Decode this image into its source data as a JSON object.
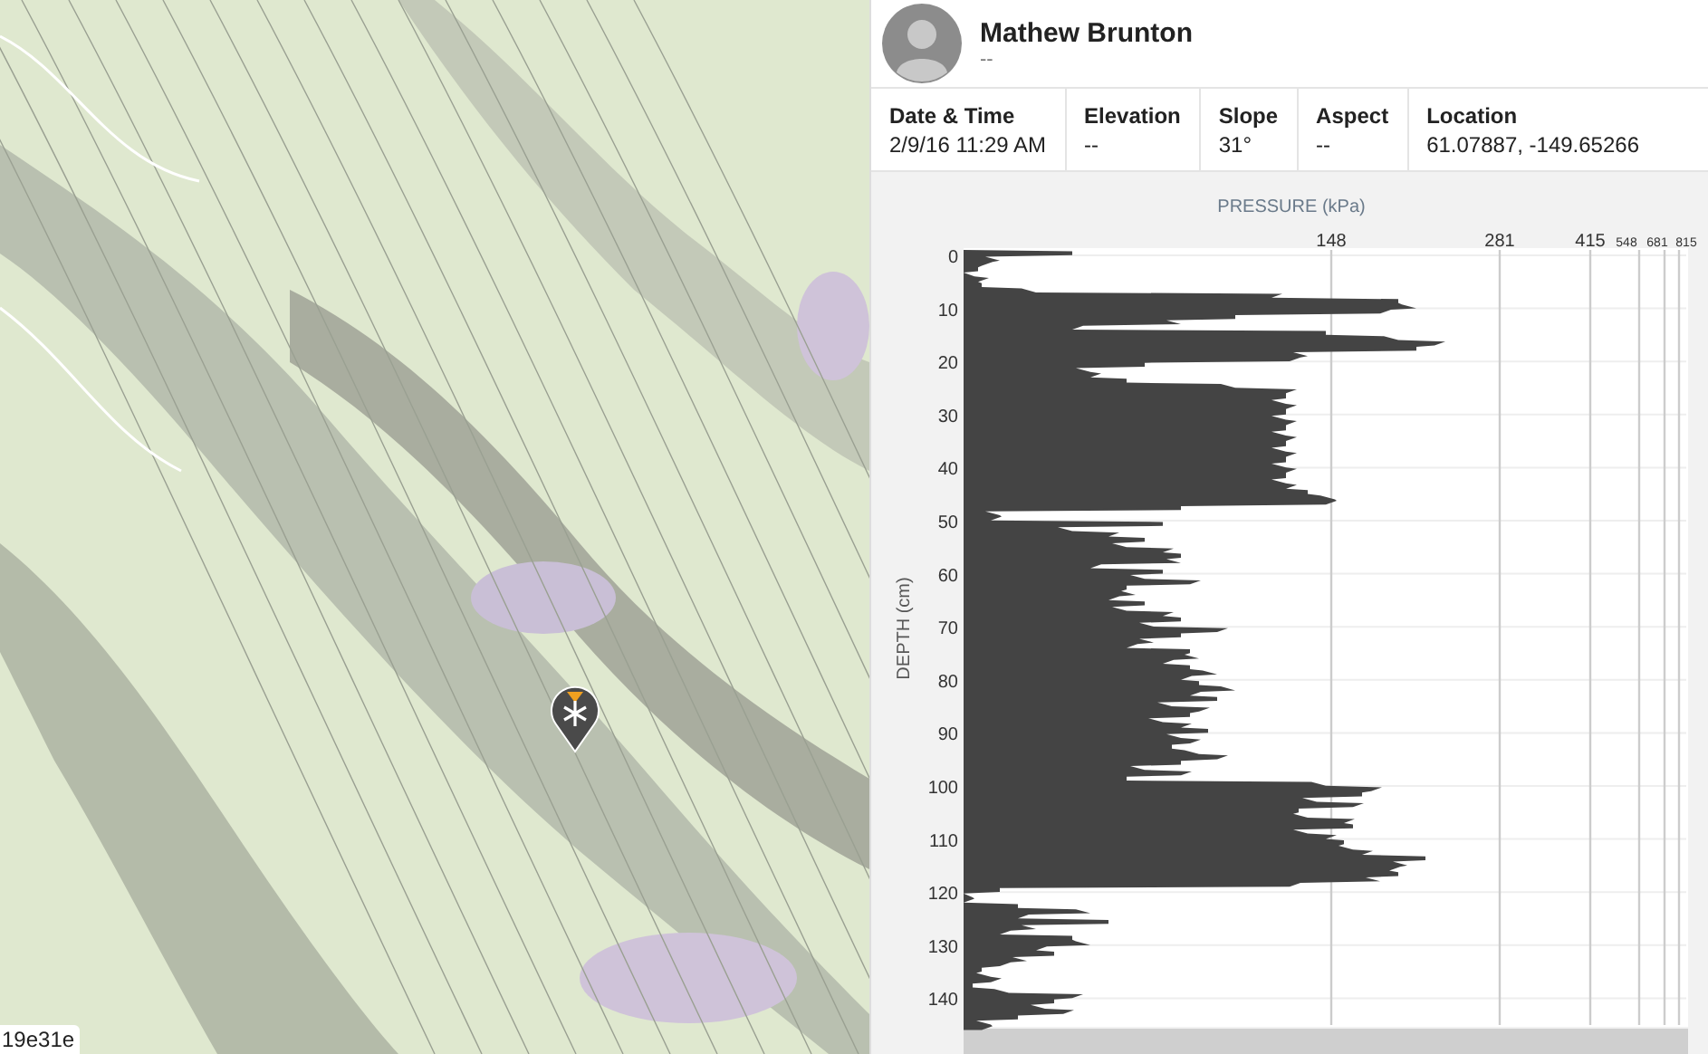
{
  "map": {
    "kind": "picture",
    "label": "19e31e"
  },
  "observer": {
    "name": "Mathew Brunton",
    "subtitle": "--"
  },
  "details": [
    {
      "label": "Date & Time",
      "value": "2/9/16 11:29 AM"
    },
    {
      "label": "Elevation",
      "value": "--"
    },
    {
      "label": "Slope",
      "value": "31°"
    },
    {
      "label": "Aspect",
      "value": "--"
    },
    {
      "label": "Location",
      "value": "61.07887, -149.65266"
    }
  ],
  "chart": {
    "title": "PRESSURE (kPa)",
    "ylabel": "DEPTH (cm)",
    "xticks": [
      "148",
      "281",
      "415",
      "548",
      "681",
      "815"
    ],
    "yticks": [
      "0",
      "10",
      "20",
      "30",
      "40",
      "50",
      "60",
      "70",
      "80",
      "90",
      "100",
      "110",
      "120",
      "130",
      "140"
    ]
  }
}
